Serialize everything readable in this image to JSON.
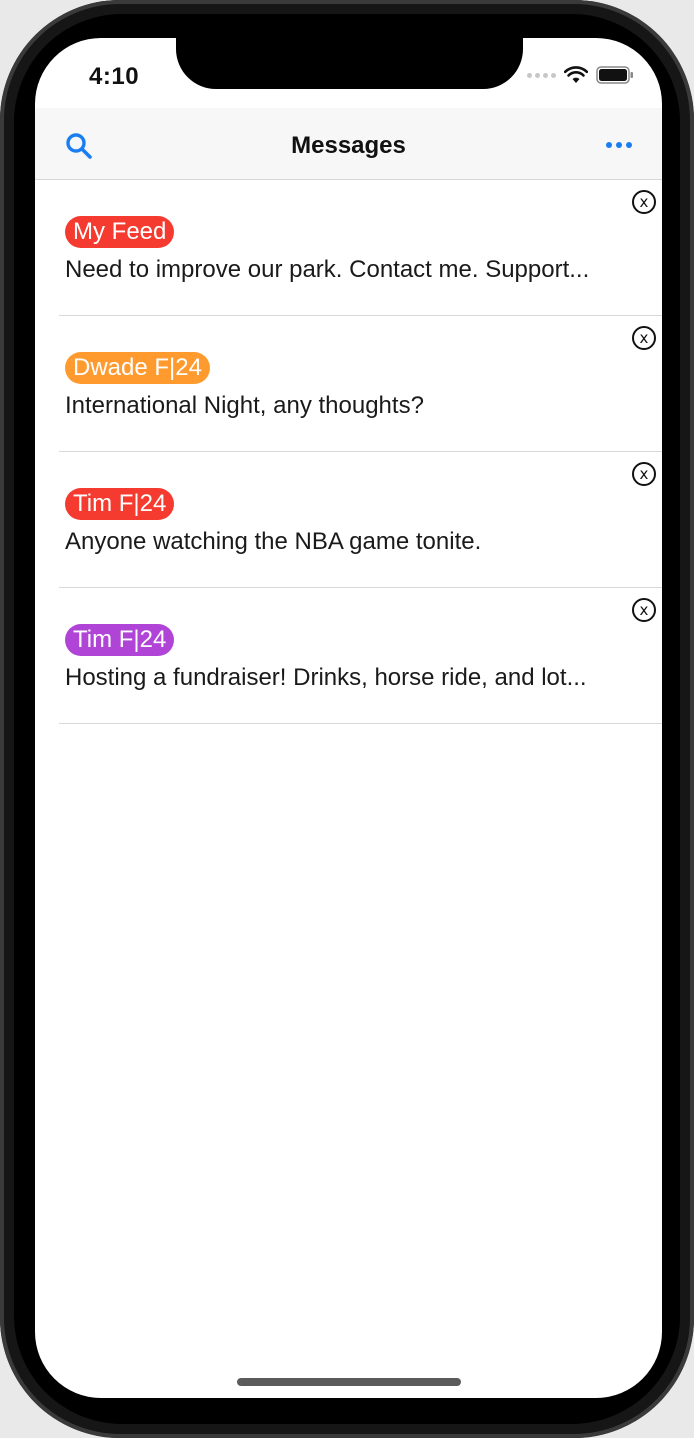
{
  "status_bar": {
    "time": "4:10"
  },
  "nav": {
    "title": "Messages",
    "search_icon": "search-icon",
    "more_icon": "more-icon"
  },
  "messages": [
    {
      "tag": "My Feed",
      "tag_color": "#f53a30",
      "preview": "Need to improve our park. Contact me. Support..."
    },
    {
      "tag": "Dwade F|24",
      "tag_color": "#ff9a2e",
      "preview": "International Night, any thoughts?"
    },
    {
      "tag": "Tim F|24",
      "tag_color": "#f53a30",
      "preview": "Anyone watching the NBA game tonite."
    },
    {
      "tag": "Tim F|24",
      "tag_color": "#b044d6",
      "preview": "Hosting a fundraiser! Drinks, horse ride, and lot..."
    }
  ],
  "close_label": "x",
  "colors": {
    "accent": "#1a7ef2"
  }
}
